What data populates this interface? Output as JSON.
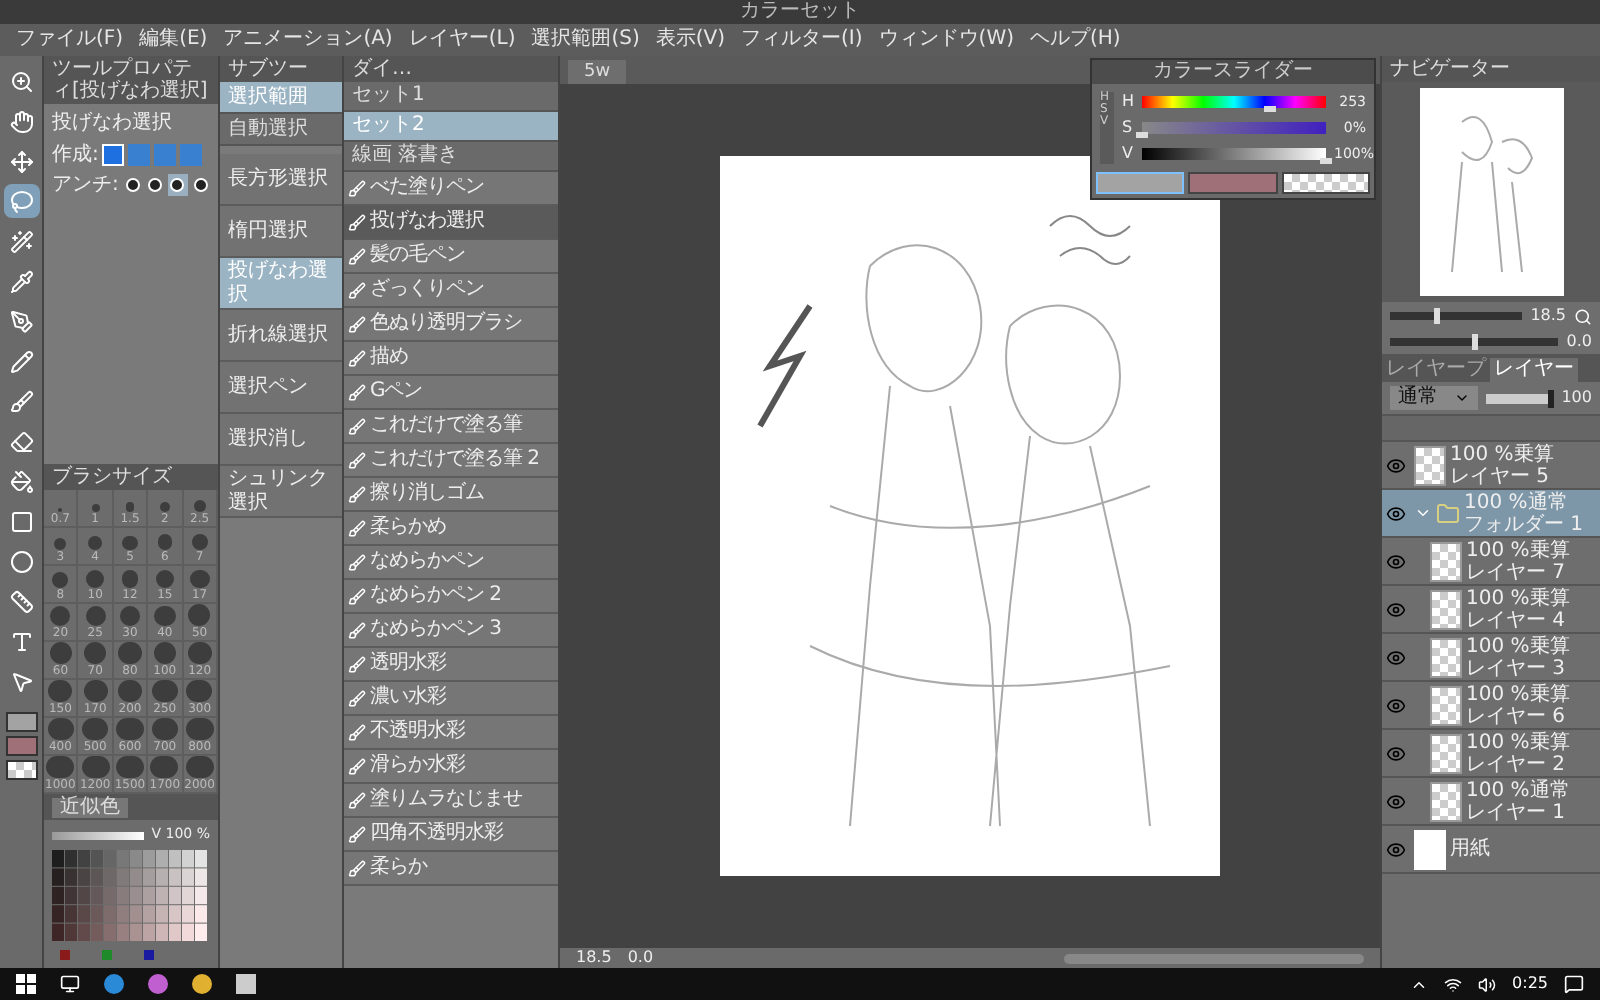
{
  "top_bar": {
    "title": "カラーセット"
  },
  "menu": [
    "ファイル(F)",
    "編集(E)",
    "アニメーション(A)",
    "レイヤー(L)",
    "選択範囲(S)",
    "表示(V)",
    "フィルター(I)",
    "ウィンドウ(W)",
    "ヘルプ(H)"
  ],
  "tools": [
    {
      "kind": "zoom",
      "selected": false
    },
    {
      "kind": "hand",
      "selected": false
    },
    {
      "kind": "move",
      "selected": false
    },
    {
      "kind": "lasso",
      "selected": true
    },
    {
      "kind": "wand",
      "selected": false
    },
    {
      "kind": "pipette",
      "selected": false
    },
    {
      "kind": "pen",
      "selected": false
    },
    {
      "kind": "pencil",
      "selected": false
    },
    {
      "kind": "brush",
      "selected": false
    },
    {
      "kind": "eraser",
      "selected": false
    },
    {
      "kind": "bucket",
      "selected": false
    },
    {
      "kind": "gradient",
      "selected": false
    },
    {
      "kind": "ellipse",
      "selected": false
    },
    {
      "kind": "ruler",
      "selected": false
    },
    {
      "kind": "text",
      "selected": false
    },
    {
      "kind": "pointer",
      "selected": false
    }
  ],
  "tool_colors": [
    {
      "kind": "main",
      "color": "#a3a3a3"
    },
    {
      "kind": "sub",
      "color": "#a07078"
    },
    {
      "kind": "transparent"
    }
  ],
  "tool_property": {
    "title": "ツールプロパティ[投げなわ選択]",
    "tool_name": "投げなわ選択",
    "rows": [
      {
        "label": "作成:",
        "kind": "mode",
        "options": [
          {
            "selected": true
          },
          {
            "selected": false
          },
          {
            "selected": false
          },
          {
            "selected": false
          }
        ]
      },
      {
        "label": "アンチ:",
        "kind": "antialias",
        "options": [
          {
            "selected": false
          },
          {
            "selected": false
          },
          {
            "selected": true
          },
          {
            "selected": false
          }
        ]
      }
    ]
  },
  "brush_size": {
    "title": "ブラシサイズ",
    "sizes": [
      "0.7",
      "1",
      "1.5",
      "2",
      "2.5",
      "3",
      "4",
      "5",
      "6",
      "7",
      "8",
      "10",
      "12",
      "15",
      "17",
      "20",
      "25",
      "30",
      "40",
      "50",
      "60",
      "70",
      "80",
      "100",
      "120",
      "150",
      "170",
      "200",
      "250",
      "300",
      "400",
      "500",
      "600",
      "700",
      "800",
      "1000",
      "1200",
      "1500",
      "1700",
      "2000"
    ]
  },
  "color_panel": {
    "tab": "近似色",
    "v_label": "V 100 %",
    "markers": [
      {
        "color": "#8b1a1a"
      },
      {
        "color": "#1f8a2a"
      },
      {
        "color": "#1a1aa0"
      }
    ]
  },
  "subtool_selection": {
    "title": "サブツー",
    "groups": [
      {
        "label": "選択範囲",
        "selected": true
      },
      {
        "label": "自動選択",
        "selected": false
      }
    ],
    "items": [
      {
        "label": "長方形選択",
        "selected": false
      },
      {
        "label": "楕円選択",
        "selected": false
      },
      {
        "label": "投げなわ選択",
        "selected": true
      },
      {
        "label": "折れ線選択",
        "selected": false
      },
      {
        "label": "選択ペン",
        "selected": false
      },
      {
        "label": "選択消し",
        "selected": false
      },
      {
        "label": "シュリンク選択",
        "selected": false
      }
    ]
  },
  "subtool_brush": {
    "title": "ダイ…",
    "sets": [
      {
        "label": "セット1",
        "selected": false
      },
      {
        "label": "セット2",
        "selected": true
      },
      {
        "label": "線画 落書き",
        "selected": false
      }
    ],
    "items": [
      {
        "label": "べた塗りペン",
        "selected": false
      },
      {
        "label": "投げなわ選択",
        "selected": true
      },
      {
        "label": "髪の毛ペン",
        "selected": false
      },
      {
        "label": "ざっくりペン",
        "selected": false
      },
      {
        "label": "色ぬり透明ブラシ",
        "selected": false
      },
      {
        "label": "描め",
        "selected": false
      },
      {
        "label": "Gペン",
        "selected": false
      },
      {
        "label": "これだけで塗る筆",
        "selected": false
      },
      {
        "label": "これだけで塗る筆 2",
        "selected": false
      },
      {
        "label": "擦り消しゴム",
        "selected": false
      },
      {
        "label": "柔らかめ",
        "selected": false
      },
      {
        "label": "なめらかペン",
        "selected": false
      },
      {
        "label": "なめらかペン 2",
        "selected": false
      },
      {
        "label": "なめらかペン 3",
        "selected": false
      },
      {
        "label": "透明水彩",
        "selected": false
      },
      {
        "label": "濃い水彩",
        "selected": false
      },
      {
        "label": "不透明水彩",
        "selected": false
      },
      {
        "label": "滑らか水彩",
        "selected": false
      },
      {
        "label": "塗りムラなじませ",
        "selected": false
      },
      {
        "label": "四角不透明水彩",
        "selected": false
      },
      {
        "label": "柔らか",
        "selected": false
      }
    ]
  },
  "canvas": {
    "tab": "5w",
    "zoom": "18.5",
    "angle": "0.0"
  },
  "color_slider": {
    "title": "カラースライダー",
    "mode": "HSV",
    "sliders": [
      {
        "label": "H",
        "kind": "hue",
        "value": "253",
        "level": 0.7
      },
      {
        "label": "S",
        "kind": "saturation",
        "value": "0%",
        "level": 0
      },
      {
        "label": "V",
        "kind": "value",
        "value": "100%",
        "level": 1
      }
    ],
    "swatches": [
      {
        "kind": "main",
        "color": "#a3a3a3",
        "selected": true
      },
      {
        "kind": "sub",
        "color": "#a07078",
        "selected": false
      },
      {
        "kind": "transparent",
        "selected": false
      }
    ]
  },
  "navigator": {
    "title": "ナビゲーター",
    "zoom": "18.5",
    "angle": "0.0",
    "zoom_slider": {
      "level": 0.35
    },
    "rotation_slider": {
      "level": 0.5
    }
  },
  "layer_panel": {
    "tabs": [
      {
        "label": "レイヤープ",
        "selected": false
      },
      {
        "label": "レイヤー",
        "selected": true
      }
    ],
    "blend": "通常",
    "opacity": "100",
    "opacity_slider": {
      "level": 1
    },
    "layers": [
      {
        "kind": "layer",
        "mode": "100 %乗算",
        "name": "レイヤー 5",
        "selected": false
      },
      {
        "kind": "folder",
        "mode": "100 %通常",
        "name": "フォルダー 1",
        "selected": true,
        "expanded": true,
        "children": [
          {
            "kind": "layer",
            "mode": "100 %乗算",
            "name": "レイヤー 7",
            "selected": false
          },
          {
            "kind": "layer",
            "mode": "100 %乗算",
            "name": "レイヤー 4",
            "selected": false
          },
          {
            "kind": "layer",
            "mode": "100 %乗算",
            "name": "レイヤー 3",
            "selected": false
          },
          {
            "kind": "layer",
            "mode": "100 %乗算",
            "name": "レイヤー 6",
            "selected": false
          },
          {
            "kind": "layer",
            "mode": "100 %乗算",
            "name": "レイヤー 2",
            "selected": false
          },
          {
            "kind": "layer",
            "mode": "100 %通常",
            "name": "レイヤー 1",
            "selected": false
          }
        ]
      },
      {
        "kind": "paper",
        "name": "用紙",
        "selected": false
      }
    ]
  },
  "taskbar": {
    "clock": "0:25"
  }
}
